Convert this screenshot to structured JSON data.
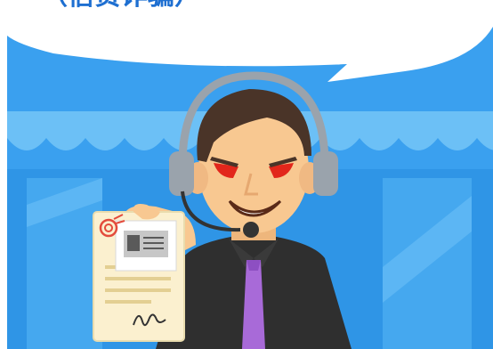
{
  "speech_bubble": {
    "headline_text": "（信贷诈骗）"
  },
  "colors": {
    "sky": "#3aa0ef",
    "sky_dark": "#2d8fe0",
    "awning": "#6cc0f6",
    "bubble": "#ffffff",
    "headline": "#1e6fd1",
    "skin": "#f8c891",
    "hair": "#4a3428",
    "eyes": "#e2261b",
    "headset": "#9aa3ac",
    "shirt": "#2f2f2f",
    "tie": "#a86ad8",
    "paper": "#fbf0cf",
    "stamp": "#e34b3c"
  },
  "icons": {
    "headset": "headset-icon",
    "id_card": "id-card-icon",
    "stamp": "seal-stamp-icon",
    "signature": "signature-icon"
  }
}
